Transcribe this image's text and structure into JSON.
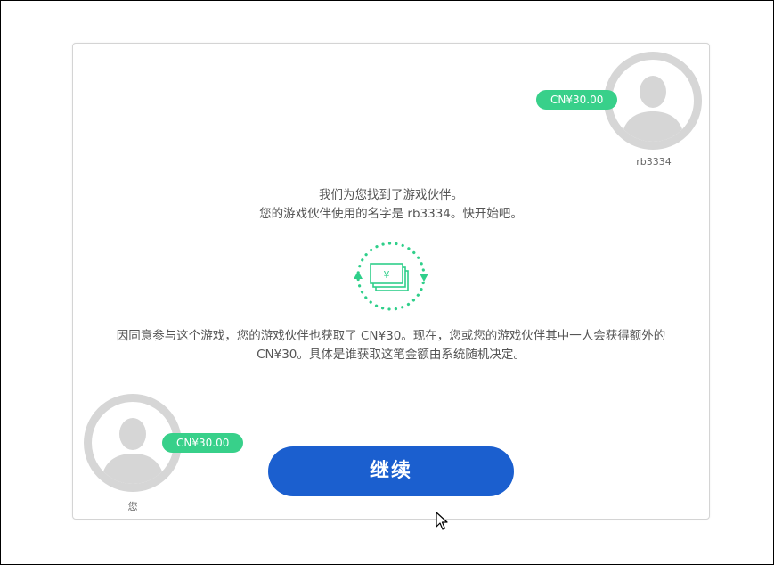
{
  "partner": {
    "name": "rb3334",
    "balance": "CN¥30.00",
    "avatar_icon": "user-silhouette-icon"
  },
  "you": {
    "name": "您",
    "balance": "CN¥30.00",
    "avatar_icon": "user-silhouette-icon"
  },
  "message_top": {
    "line1": "我们为您找到了游戏伙伴。",
    "line2": "您的游戏伙伴使用的名字是 rb3334。快开始吧。"
  },
  "message_bottom": {
    "line1": "因同意参与这个游戏，您的游戏伙伴也获取了 CN¥30。现在，您或您的游戏伙伴其中一人会获得额外的",
    "line2": "CN¥30。具体是谁获取这笔金额由系统随机决定。"
  },
  "exchange": {
    "icon": "money-exchange-icon",
    "currency_symbol": "¥"
  },
  "continue_button": {
    "label": "继续"
  },
  "colors": {
    "badge": "#38d08a",
    "button": "#1b5fcf",
    "avatar_ring": "#d6d6d6",
    "accent_green": "#2fcf8a"
  }
}
